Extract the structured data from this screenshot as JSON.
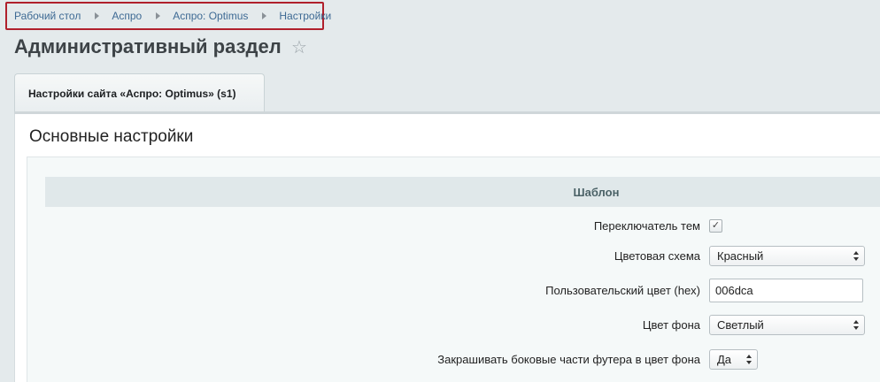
{
  "breadcrumb": {
    "items": [
      "Рабочий стол",
      "Аспро",
      "Аспро: Optimus",
      "Настройки"
    ]
  },
  "page": {
    "title": "Административный раздел"
  },
  "tabs": [
    {
      "label": "Настройки сайта «Аспро: Optimus» (s1)"
    }
  ],
  "section": {
    "title": "Основные настройки",
    "group_header": "Шаблон"
  },
  "fields": {
    "theme_switcher": {
      "label": "Переключатель тем",
      "checked": true
    },
    "color_scheme": {
      "label": "Цветовая схема",
      "value": "Красный"
    },
    "custom_color": {
      "label": "Пользовательский цвет (hex)",
      "value": "006dca"
    },
    "bg_color": {
      "label": "Цвет фона",
      "value": "Светлый"
    },
    "footer_fill": {
      "label": "Закрашивать боковые части футера в цвет фона",
      "value": "Да"
    }
  },
  "icons": {
    "star": "star-icon",
    "chevron": "chevron-updown-icon",
    "check": "check-icon"
  },
  "colors": {
    "link": "#3e6a94",
    "highlight_border": "#b0202c",
    "background": "#e4eaec"
  }
}
